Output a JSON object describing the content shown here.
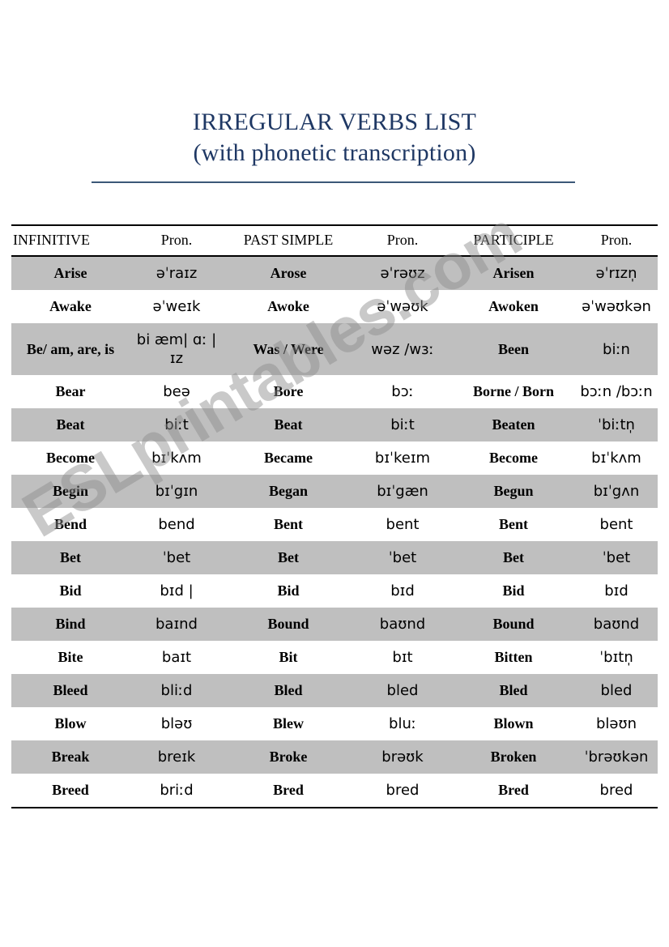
{
  "title": {
    "line1": "IRREGULAR VERBS LIST",
    "line2": "(with phonetic transcription)",
    "color": "#1F3864",
    "rule_color": "#3B5878"
  },
  "watermark": {
    "text": "ESLprintables.com",
    "color": "#8C8C8C"
  },
  "table": {
    "shade_color": "#BFBFBF",
    "headers": [
      "INFINITIVE",
      "Pron.",
      "PAST SIMPLE",
      "Pron.",
      "PARTICIPLE",
      "Pron."
    ],
    "rows": [
      {
        "shaded": true,
        "infinitive": "Arise",
        "pron1": "əˈraɪz",
        "past": "Arose",
        "pron2": "əˈrəʊz",
        "participle": "Arisen",
        "pron3": "əˈrɪzn̩"
      },
      {
        "shaded": false,
        "infinitive": "Awake",
        "pron1": "əˈweɪk",
        "past": "Awoke",
        "pron2": "əˈwəʊk",
        "participle": "Awoken",
        "pron3": "əˈwəʊkən"
      },
      {
        "shaded": true,
        "infinitive": "Be/ am, are, is",
        "pron1": "bi æm| ɑː | ɪz",
        "past": "Was / Were",
        "pron2": "wəz /wɜː",
        "participle": "Been",
        "pron3": "biːn"
      },
      {
        "shaded": false,
        "infinitive": "Bear",
        "pron1": "beə",
        "past": "Bore",
        "pron2": "bɔː",
        "participle": "Borne / Born",
        "pron3": "bɔːn /bɔːn"
      },
      {
        "shaded": true,
        "infinitive": "Beat",
        "pron1": "biːt",
        "past": "Beat",
        "pron2": "biːt",
        "participle": "Beaten",
        "pron3": "ˈbiːtn̩"
      },
      {
        "shaded": false,
        "infinitive": "Become",
        "pron1": "bɪˈkʌm",
        "past": "Became",
        "pron2": "bɪˈkeɪm",
        "participle": "Become",
        "pron3": "bɪˈkʌm"
      },
      {
        "shaded": true,
        "infinitive": "Begin",
        "pron1": "bɪˈgɪn",
        "past": "Began",
        "pron2": "bɪˈgæn",
        "participle": "Begun",
        "pron3": "bɪˈgʌn"
      },
      {
        "shaded": false,
        "infinitive": "Bend",
        "pron1": "bend",
        "past": "Bent",
        "pron2": "bent",
        "participle": "Bent",
        "pron3": "bent"
      },
      {
        "shaded": true,
        "infinitive": "Bet",
        "pron1": "ˈbet",
        "past": "Bet",
        "pron2": "ˈbet",
        "participle": "Bet",
        "pron3": "ˈbet"
      },
      {
        "shaded": false,
        "infinitive": "Bid",
        "pron1": "bɪd |",
        "past": "Bid",
        "pron2": "bɪd",
        "participle": "Bid",
        "pron3": "bɪd"
      },
      {
        "shaded": true,
        "infinitive": "Bind",
        "pron1": "baɪnd",
        "past": "Bound",
        "pron2": "baʊnd",
        "participle": "Bound",
        "pron3": "baʊnd"
      },
      {
        "shaded": false,
        "infinitive": "Bite",
        "pron1": "baɪt",
        "past": "Bit",
        "pron2": "bɪt",
        "participle": "Bitten",
        "pron3": "ˈbɪtn̩"
      },
      {
        "shaded": true,
        "infinitive": "Bleed",
        "pron1": "bliːd",
        "past": "Bled",
        "pron2": "bled",
        "participle": "Bled",
        "pron3": "bled"
      },
      {
        "shaded": false,
        "infinitive": "Blow",
        "pron1": "bləʊ",
        "past": "Blew",
        "pron2": "bluː",
        "participle": "Blown",
        "pron3": "bləʊn"
      },
      {
        "shaded": true,
        "infinitive": "Break",
        "pron1": "breɪk",
        "past": "Broke",
        "pron2": "brəʊk",
        "participle": "Broken",
        "pron3": "ˈbrəʊkən"
      },
      {
        "shaded": false,
        "infinitive": "Breed",
        "pron1": "briːd",
        "past": "Bred",
        "pron2": "bred",
        "participle": "Bred",
        "pron3": "bred"
      }
    ]
  }
}
